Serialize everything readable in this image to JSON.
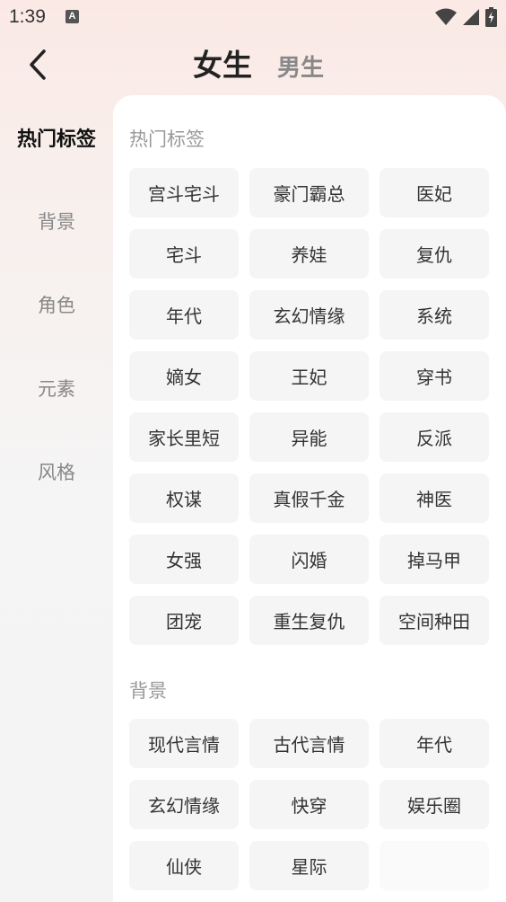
{
  "status_bar": {
    "time": "1:39",
    "notification_badge": "A",
    "icons": [
      "wifi-icon",
      "signal-icon",
      "battery-icon"
    ]
  },
  "header": {
    "tabs": [
      {
        "label": "女生",
        "active": true
      },
      {
        "label": "男生",
        "active": false
      }
    ]
  },
  "sidebar": {
    "items": [
      {
        "label": "热门标签",
        "active": true
      },
      {
        "label": "背景",
        "active": false
      },
      {
        "label": "角色",
        "active": false
      },
      {
        "label": "元素",
        "active": false
      },
      {
        "label": "风格",
        "active": false
      }
    ]
  },
  "sections": [
    {
      "title": "热门标签",
      "tags": [
        "宫斗宅斗",
        "豪门霸总",
        "医妃",
        "宅斗",
        "养娃",
        "复仇",
        "年代",
        "玄幻情缘",
        "系统",
        "嫡女",
        "王妃",
        "穿书",
        "家长里短",
        "异能",
        "反派",
        "权谋",
        "真假千金",
        "神医",
        "女强",
        "闪婚",
        "掉马甲",
        "团宠",
        "重生复仇",
        "空间种田"
      ]
    },
    {
      "title": "背景",
      "tags": [
        "现代言情",
        "古代言情",
        "年代",
        "玄幻情缘",
        "快穿",
        "娱乐圈",
        "仙侠",
        "星际",
        ""
      ]
    }
  ],
  "colors": {
    "accent_text": "#222222",
    "muted_text": "#888888",
    "tag_bg": "#f5f5f6",
    "panel_bg": "#ffffff"
  }
}
